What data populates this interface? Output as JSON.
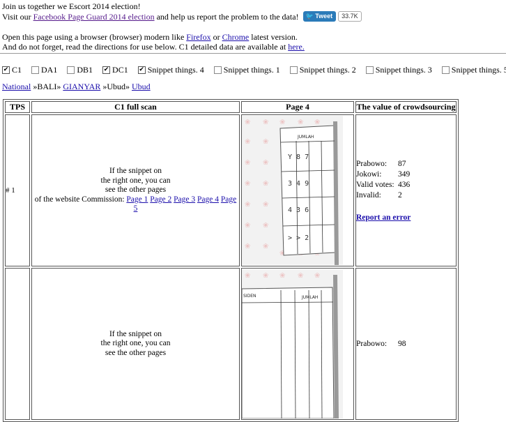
{
  "intro": {
    "line1": "Join us together we Escort 2014 election!",
    "line2_prefix": "Visit our ",
    "line2_link": "Facebook Page Guard 2014 election",
    "line2_suffix": " and help us report the problem to the data!",
    "tweet_label": "Tweet",
    "tweet_count": "33.7K",
    "line3_prefix": "Open this page using a browser (browser) modern like ",
    "firefox": "Firefox",
    "or": " or ",
    "chrome": "Chrome",
    "line3_suffix": " latest version.",
    "line4_prefix": "And do not forget, read the directions for use below. C1 detailed data are available at ",
    "here": "here."
  },
  "filters": [
    {
      "label": "C1",
      "checked": true
    },
    {
      "label": "DA1",
      "checked": false
    },
    {
      "label": "DB1",
      "checked": false
    },
    {
      "label": "DC1",
      "checked": true
    },
    {
      "label": "Snippet things. 4",
      "checked": true
    },
    {
      "label": "Snippet things. 1",
      "checked": false
    },
    {
      "label": "Snippet things. 2",
      "checked": false
    },
    {
      "label": "Snippet things. 3",
      "checked": false
    },
    {
      "label": "Snippet things. 5",
      "checked": false
    }
  ],
  "breadcrumb": {
    "national": "National",
    "sep1": " »BALI» ",
    "gianyar": "GIANYAR",
    "sep2": " »Ubud» ",
    "ubud": "Ubud"
  },
  "table": {
    "headers": [
      "TPS",
      "C1 full scan",
      "Page 4",
      "The value of crowdsourcing"
    ],
    "scan_text": [
      "If the snippet on",
      "the right one, you can",
      "see the other pages",
      "of the website Commission: "
    ],
    "page_links": [
      "Page 1",
      "Page 2",
      "Page 3",
      "Page 4",
      "Page 5"
    ],
    "rows": [
      {
        "tps": "# 1",
        "snippet_header": "JUMLAH",
        "snippet_digits": [
          "Y 8 7",
          "3 4 9",
          "4 3 6",
          "> > 2"
        ],
        "votes": [
          {
            "label": "Prabowo:",
            "value": "87"
          },
          {
            "label": "Jokowi:",
            "value": "349"
          },
          {
            "label": "Valid votes:",
            "value": "436"
          },
          {
            "label": "Invalid:",
            "value": "2"
          }
        ],
        "report": "Report an error"
      },
      {
        "tps": "",
        "snippet_header": "JUMLAH",
        "snippet_header_left": "SIDEN",
        "votes": [
          {
            "label": "Prabowo:",
            "value": "98"
          }
        ]
      }
    ]
  },
  "colors": {
    "link": "#1a0dab",
    "visited": "#551a8b",
    "tweet": "#2b7bb9",
    "watermark": "#e8a0a0"
  }
}
